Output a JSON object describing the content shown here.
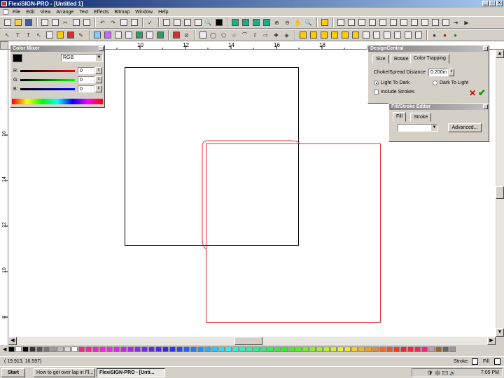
{
  "window": {
    "title": "FlexiSIGN-PRO - [Untitled 1]",
    "min": "_",
    "max": "□",
    "close": "×"
  },
  "menu": [
    "File",
    "Edit",
    "View",
    "Arrange",
    "Text",
    "Effects",
    "Bitmap",
    "Window",
    "Help"
  ],
  "ruler": {
    "h_ticks": [
      "10",
      "12",
      "14",
      "16",
      "18"
    ],
    "v_ticks": [
      "18",
      "16",
      "14",
      "12",
      "10",
      "8"
    ]
  },
  "color_mixer": {
    "title": "Color Mixer",
    "mode": "RGB",
    "channels": [
      {
        "label": "R:",
        "value": "0"
      },
      {
        "label": "G:",
        "value": "0"
      },
      {
        "label": "B:",
        "value": "0"
      }
    ]
  },
  "design_central": {
    "title": "DesignCentral",
    "tabs": [
      "Size",
      "Rotate",
      "Color Trapping"
    ],
    "choke_label": "Choke/Spread Distance",
    "choke_value": "0.200in",
    "light_to_dark": "Light To Dark",
    "dark_to_light": "Dark To Light",
    "include_strokes": "Include Strokes"
  },
  "fill_stroke": {
    "title": "Fill/Stroke Editor",
    "tabs": [
      "Fill",
      "Stroke"
    ],
    "advanced": "Advanced..."
  },
  "status": {
    "coords": "( 19.913,  16.597)",
    "stroke": "Stroke",
    "fill": "Fill"
  },
  "taskbar": {
    "start": "Start",
    "task1": "How to get over lap in Fl...",
    "task2": "FlexiSIGN-PRO - [Unti...",
    "clock": "7:05 PM"
  },
  "colors": {
    "trap_outline": "#e03030",
    "accent": "#0a246a"
  }
}
